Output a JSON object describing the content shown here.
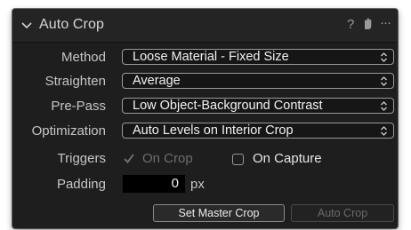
{
  "header": {
    "title": "Auto Crop",
    "help_glyph": "?",
    "menu_glyph": "···"
  },
  "fields": {
    "method": {
      "label": "Method",
      "value": "Loose Material - Fixed Size"
    },
    "straighten": {
      "label": "Straighten",
      "value": "Average"
    },
    "prepass": {
      "label": "Pre-Pass",
      "value": "Low Object-Background Contrast"
    },
    "optimization": {
      "label": "Optimization",
      "value": "Auto Levels on Interior Crop"
    }
  },
  "triggers": {
    "label": "Triggers",
    "on_crop": {
      "label": "On Crop",
      "checked": true,
      "enabled": false
    },
    "on_capture": {
      "label": "On Capture",
      "checked": false,
      "enabled": true
    }
  },
  "padding": {
    "label": "Padding",
    "value": "0",
    "unit": "px"
  },
  "buttons": {
    "set_master_crop": {
      "label": "Set Master Crop",
      "enabled": true
    },
    "auto_crop": {
      "label": "Auto Crop",
      "enabled": false
    }
  },
  "colors": {
    "panel_bg": "#1e1e1e",
    "header_bg": "#242424",
    "label_text": "#c6c6c6",
    "value_text": "#f2f2f2",
    "disabled_text": "#6e6e6e",
    "input_bg": "#000000"
  },
  "icons": {
    "header_collapse": "chevron-down-icon",
    "help": "question-icon",
    "reset": "reset-hand-icon",
    "more": "ellipsis-icon",
    "select_arrows": "up-down-chevron-icon",
    "checkmark": "checkmark-icon"
  }
}
